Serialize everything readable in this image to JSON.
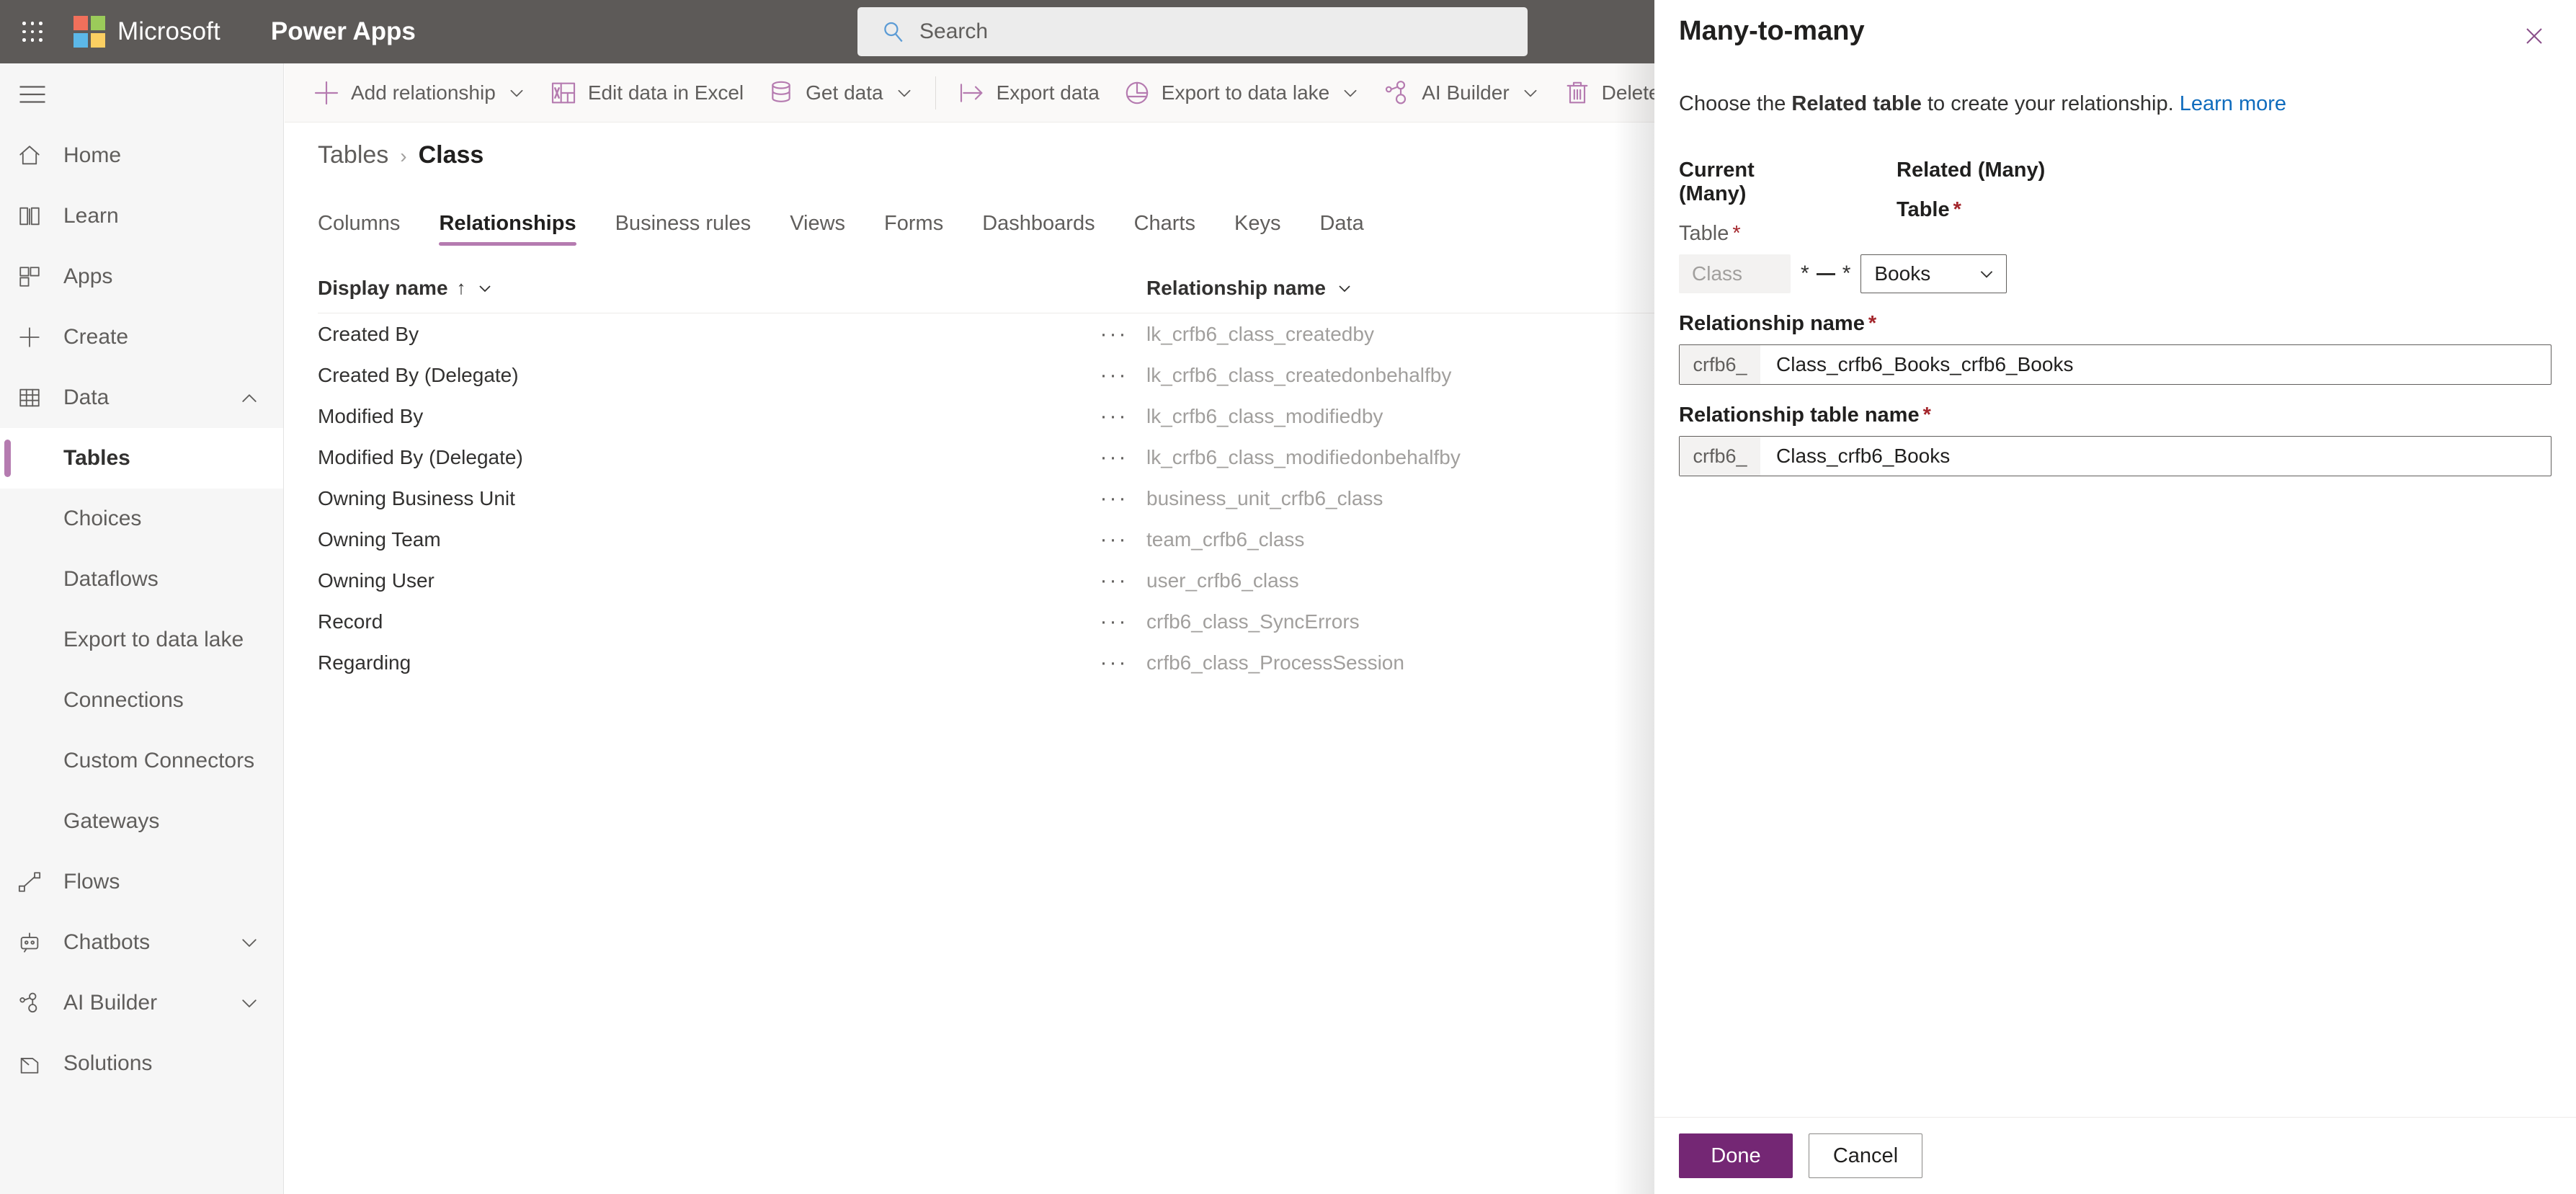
{
  "suitebar": {
    "waffle_label": "App launcher",
    "brand": "Microsoft",
    "app_name": "Power Apps",
    "search_placeholder": "Search"
  },
  "sidebar": {
    "items": [
      {
        "label": "Home",
        "icon": "home-icon",
        "level": "top",
        "chevron": "",
        "active": false
      },
      {
        "label": "Learn",
        "icon": "book-icon",
        "level": "top",
        "chevron": "",
        "active": false
      },
      {
        "label": "Apps",
        "icon": "apps-grid-icon",
        "level": "top",
        "chevron": "",
        "active": false
      },
      {
        "label": "Create",
        "icon": "plus-icon",
        "level": "top",
        "chevron": "",
        "active": false
      },
      {
        "label": "Data",
        "icon": "table-icon",
        "level": "top",
        "chevron": "up",
        "active": false
      },
      {
        "label": "Tables",
        "icon": "",
        "level": "sub",
        "chevron": "",
        "active": true
      },
      {
        "label": "Choices",
        "icon": "",
        "level": "sub",
        "chevron": "",
        "active": false
      },
      {
        "label": "Dataflows",
        "icon": "",
        "level": "sub",
        "chevron": "",
        "active": false
      },
      {
        "label": "Export to data lake",
        "icon": "",
        "level": "sub",
        "chevron": "",
        "active": false
      },
      {
        "label": "Connections",
        "icon": "",
        "level": "sub",
        "chevron": "",
        "active": false
      },
      {
        "label": "Custom Connectors",
        "icon": "",
        "level": "sub",
        "chevron": "",
        "active": false
      },
      {
        "label": "Gateways",
        "icon": "",
        "level": "sub",
        "chevron": "",
        "active": false
      },
      {
        "label": "Flows",
        "icon": "flow-icon",
        "level": "top",
        "chevron": "",
        "active": false
      },
      {
        "label": "Chatbots",
        "icon": "robot-icon",
        "level": "top",
        "chevron": "down",
        "active": false
      },
      {
        "label": "AI Builder",
        "icon": "ai-builder-icon",
        "level": "top",
        "chevron": "down",
        "active": false
      },
      {
        "label": "Solutions",
        "icon": "solutions-icon",
        "level": "top",
        "chevron": "",
        "active": false
      }
    ]
  },
  "commandbar": {
    "items": [
      {
        "label": "Add relationship",
        "icon": "plus-icon",
        "chevron": true,
        "sep_after": false
      },
      {
        "label": "Edit data in Excel",
        "icon": "excel-icon",
        "chevron": false,
        "sep_after": false
      },
      {
        "label": "Get data",
        "icon": "database-icon",
        "chevron": true,
        "sep_after": true
      },
      {
        "label": "Export data",
        "icon": "export-icon",
        "chevron": false,
        "sep_after": false
      },
      {
        "label": "Export to data lake",
        "icon": "data-lake-icon",
        "chevron": true,
        "sep_after": false
      },
      {
        "label": "AI Builder",
        "icon": "ai-builder-icon",
        "chevron": true,
        "sep_after": false
      },
      {
        "label": "Delete table",
        "icon": "trash-icon",
        "chevron": false,
        "sep_after": false
      }
    ]
  },
  "breadcrumb": {
    "parent": "Tables",
    "separator": "›",
    "current": "Class"
  },
  "tabs": [
    {
      "label": "Columns",
      "active": false
    },
    {
      "label": "Relationships",
      "active": true
    },
    {
      "label": "Business rules",
      "active": false
    },
    {
      "label": "Views",
      "active": false
    },
    {
      "label": "Forms",
      "active": false
    },
    {
      "label": "Dashboards",
      "active": false
    },
    {
      "label": "Charts",
      "active": false
    },
    {
      "label": "Keys",
      "active": false
    },
    {
      "label": "Data",
      "active": false
    }
  ],
  "grid": {
    "columns": [
      {
        "label": "Display name",
        "sort": "↑"
      },
      {
        "label": "Relationship name",
        "sort": ""
      }
    ],
    "ellipsis": "···",
    "rows": [
      {
        "display_name": "Created By",
        "relationship_name": "lk_crfb6_class_createdby"
      },
      {
        "display_name": "Created By (Delegate)",
        "relationship_name": "lk_crfb6_class_createdonbehalfby"
      },
      {
        "display_name": "Modified By",
        "relationship_name": "lk_crfb6_class_modifiedby"
      },
      {
        "display_name": "Modified By (Delegate)",
        "relationship_name": "lk_crfb6_class_modifiedonbehalfby"
      },
      {
        "display_name": "Owning Business Unit",
        "relationship_name": "business_unit_crfb6_class"
      },
      {
        "display_name": "Owning Team",
        "relationship_name": "team_crfb6_class"
      },
      {
        "display_name": "Owning User",
        "relationship_name": "user_crfb6_class"
      },
      {
        "display_name": "Record",
        "relationship_name": "crfb6_class_SyncErrors"
      },
      {
        "display_name": "Regarding",
        "relationship_name": "crfb6_class_ProcessSession"
      }
    ]
  },
  "panel": {
    "title": "Many-to-many",
    "close_label": "Close",
    "description_prefix": "Choose the ",
    "description_bold": "Related table",
    "description_suffix": " to create your relationship. ",
    "learn_more": "Learn more",
    "current": {
      "section_label": "Current (Many)",
      "field_label": "Table",
      "value": "Class"
    },
    "relation_marks": {
      "left": "*",
      "right": "*"
    },
    "related": {
      "section_label": "Related (Many)",
      "field_label": "Table",
      "value": "Books"
    },
    "relationship_name": {
      "label": "Relationship name",
      "prefix": "crfb6_",
      "value": "Class_crfb6_Books_crfb6_Books"
    },
    "relationship_table_name": {
      "label": "Relationship table name",
      "prefix": "crfb6_",
      "value": "Class_crfb6_Books"
    },
    "footer": {
      "done_label": "Done",
      "cancel_label": "Cancel"
    }
  },
  "colors": {
    "suitebar_bg": "#5d5a58",
    "accent_purple": "#b57bb0",
    "primary_button": "#742774",
    "link_blue": "#0f6cbd",
    "required_red": "#a4262c"
  }
}
